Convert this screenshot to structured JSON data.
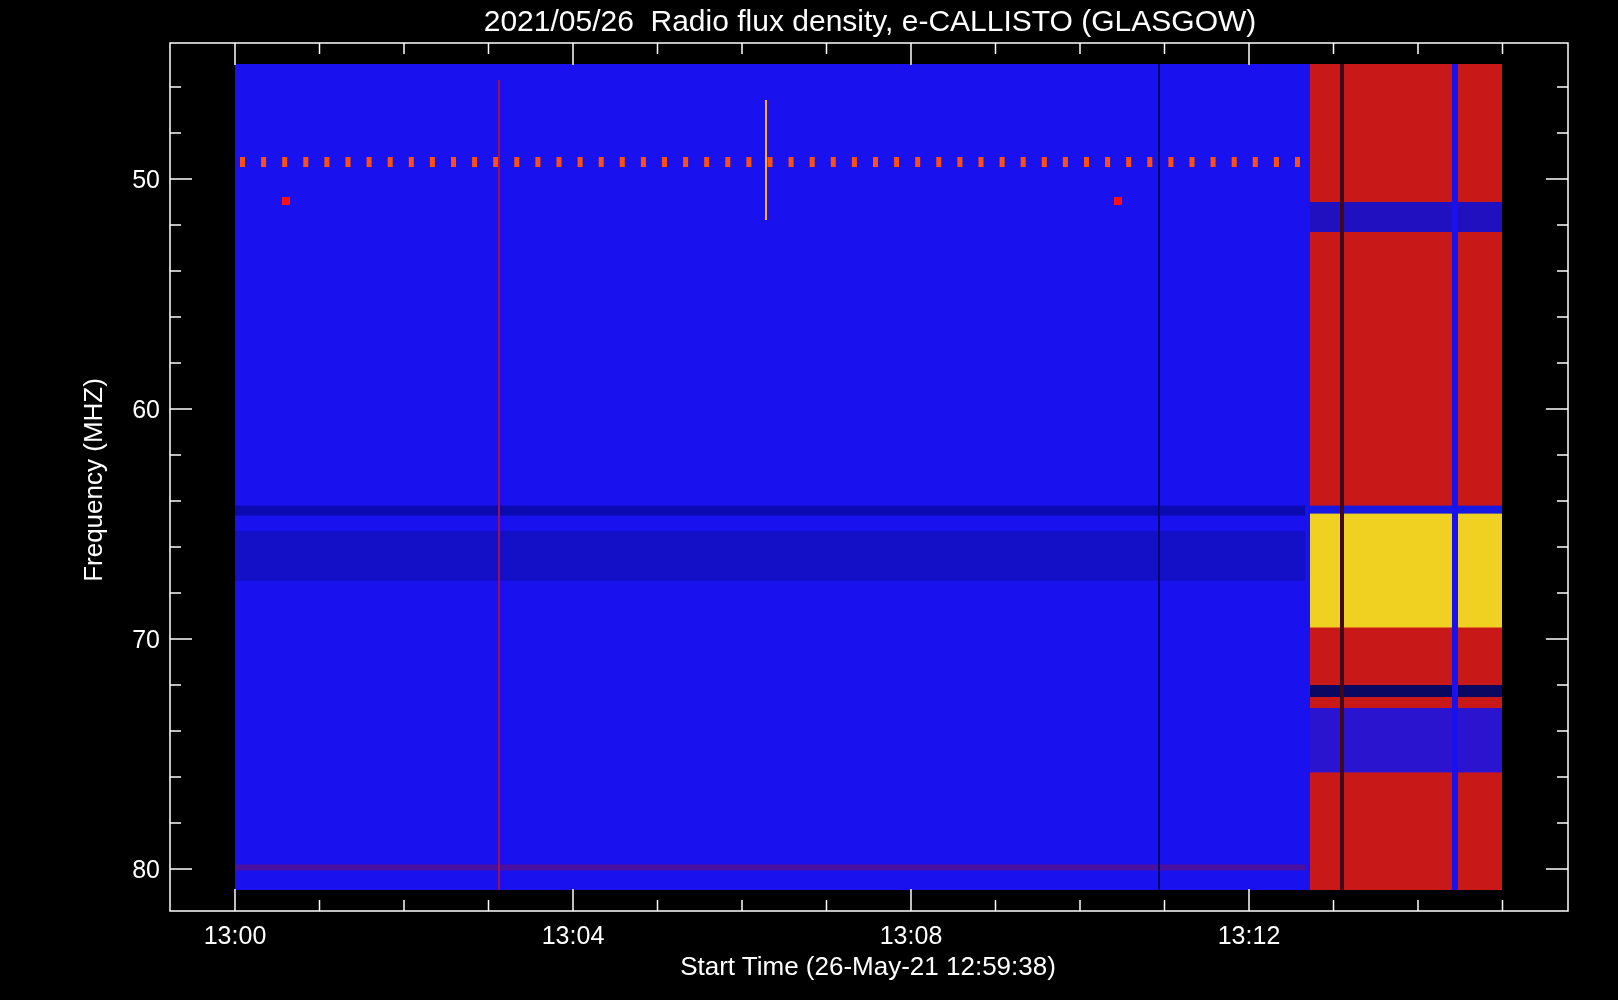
{
  "title": "2021/05/26  Radio flux density, e-CALLISTO (GLASGOW)",
  "x_axis": {
    "label": "Start Time (26-May-21 12:59:38)",
    "ticks": [
      "13:00",
      "13:04",
      "13:08",
      "13:12"
    ]
  },
  "y_axis": {
    "label": "Frequency (MHZ)",
    "ticks": [
      "50",
      "60",
      "70",
      "80"
    ]
  }
}
